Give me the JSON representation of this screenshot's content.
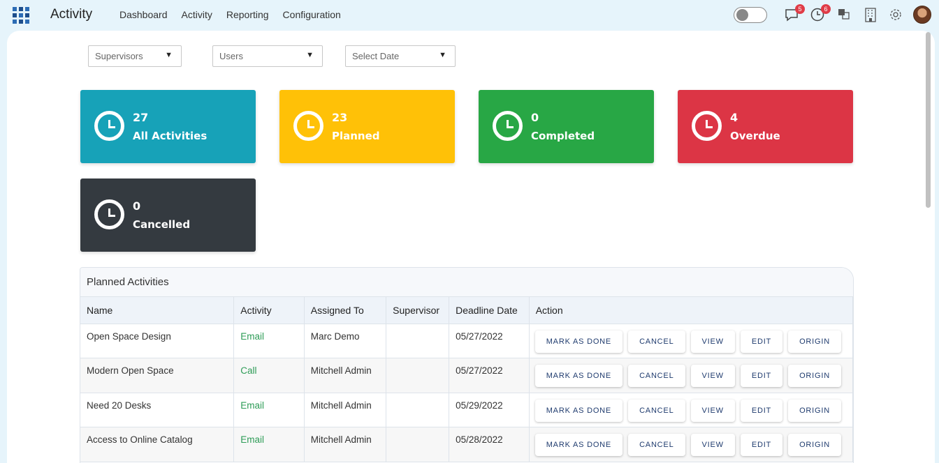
{
  "app": {
    "title": "Activity",
    "nav": [
      "Dashboard",
      "Activity",
      "Reporting",
      "Configuration"
    ]
  },
  "topbar": {
    "messages_badge": "5",
    "activities_badge": "6",
    "icons": [
      "apps-grid-icon",
      "chat-icon",
      "clock-icon",
      "translate-icon",
      "building-icon",
      "gear-icon"
    ]
  },
  "filters": {
    "supervisors": "Supervisors",
    "users": "Users",
    "date": "Select Date"
  },
  "cards": [
    {
      "count": "27",
      "label": "All Activities",
      "color": "#17a2b8"
    },
    {
      "count": "23",
      "label": "Planned",
      "color": "#ffc107"
    },
    {
      "count": "0",
      "label": "Completed",
      "color": "#28a745"
    },
    {
      "count": "4",
      "label": "Overdue",
      "color": "#dc3545"
    },
    {
      "count": "0",
      "label": "Cancelled",
      "color": "#343a40"
    }
  ],
  "table": {
    "title": "Planned Activities",
    "headers": [
      "Name",
      "Activity",
      "Assigned To",
      "Supervisor",
      "Deadline Date",
      "Action"
    ],
    "buttons": [
      "MARK AS DONE",
      "CANCEL",
      "VIEW",
      "EDIT",
      "ORIGIN"
    ],
    "rows": [
      {
        "name": "Open Space Design",
        "activity": "Email",
        "assigned": "Marc Demo",
        "supervisor": "",
        "deadline": "05/27/2022"
      },
      {
        "name": "Modern Open Space",
        "activity": "Call",
        "assigned": "Mitchell Admin",
        "supervisor": "",
        "deadline": "05/27/2022"
      },
      {
        "name": "Need 20 Desks",
        "activity": "Email",
        "assigned": "Mitchell Admin",
        "supervisor": "",
        "deadline": "05/29/2022"
      },
      {
        "name": "Access to Online Catalog",
        "activity": "Email",
        "assigned": "Mitchell Admin",
        "supervisor": "",
        "deadline": "05/28/2022"
      }
    ]
  }
}
